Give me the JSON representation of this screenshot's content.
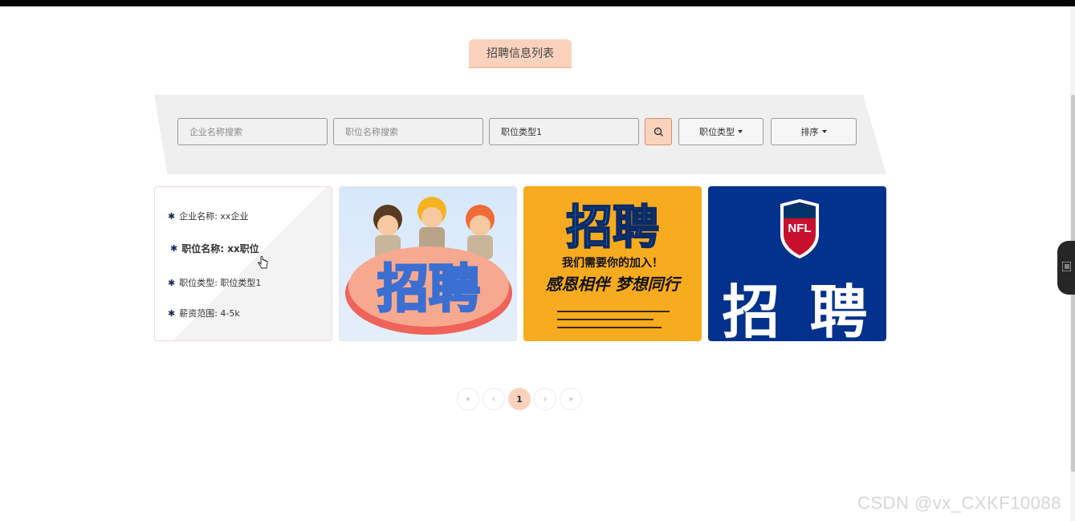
{
  "page_title": "招聘信息列表",
  "search": {
    "company_placeholder": "企业名称搜索",
    "position_placeholder": "职位名称搜索",
    "type_value": "职位类型1",
    "type_dropdown_label": "职位类型",
    "sort_dropdown_label": "排序"
  },
  "cards": [
    {
      "company_label": "企业名称: xx企业",
      "position_label": "职位名称: xx职位",
      "type_label": "职位类型: 职位类型1",
      "salary_label": "薪资范围: 4-5k"
    }
  ],
  "images": {
    "image2_text": "招聘",
    "image3_title": "招聘",
    "image3_sub": "我们需要你的加入！",
    "image3_slogan": "感恩相伴 梦想同行",
    "image4_text": "招 聘",
    "image4_logo": "NFL"
  },
  "pagination": {
    "first": "«",
    "prev": "‹",
    "current": "1",
    "next": "›",
    "last": "»"
  },
  "watermark": "CSDN @vx_CXKF10088",
  "colors": {
    "accent": "#fbd3bd",
    "search_bg": "#efefef",
    "card3_bg": "#f7ab1e",
    "card4_bg": "#02328e"
  }
}
